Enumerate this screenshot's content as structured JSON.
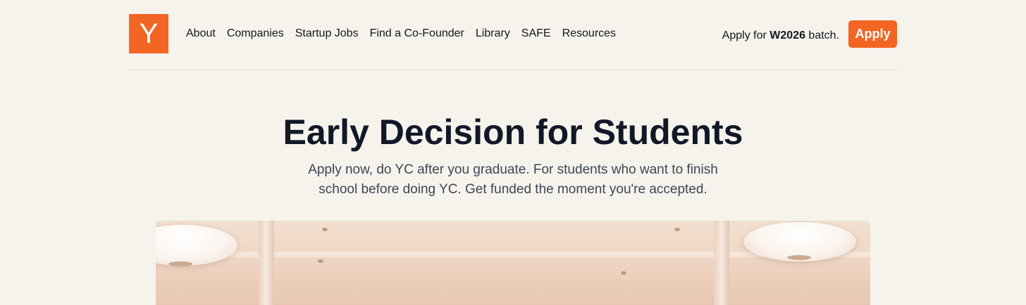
{
  "nav": {
    "logo_letter": "Y",
    "links": [
      "About",
      "Companies",
      "Startup Jobs",
      "Find a Co-Founder",
      "Library",
      "SAFE",
      "Resources"
    ],
    "apply_prefix": "Apply for ",
    "apply_batch": "W2026",
    "apply_suffix": " batch.",
    "apply_button": "Apply"
  },
  "hero": {
    "title": "Early Decision for Students",
    "subtitle": "Apply now, do YC after you graduate. For students who want to finish school before doing YC. Get funded the moment you're accepted."
  },
  "colors": {
    "brand_orange": "#f26522",
    "background": "#f5f3ec",
    "heading": "#111827"
  },
  "icons": {
    "logo": "yc-logo-icon"
  }
}
